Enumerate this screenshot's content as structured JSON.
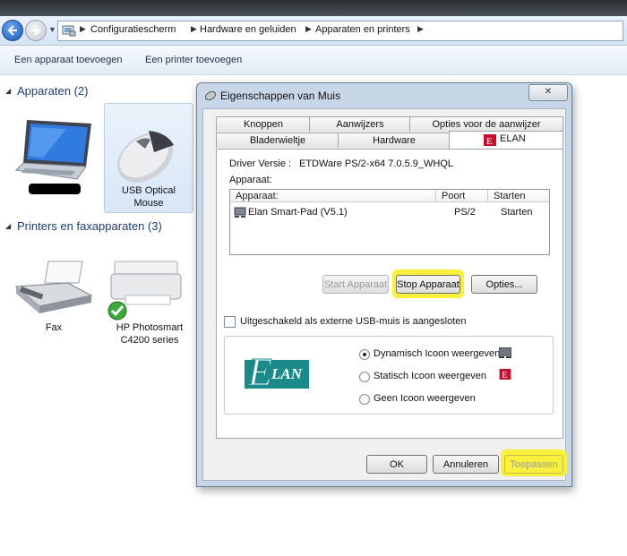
{
  "breadcrumb": [
    "Configuratiescherm",
    "Hardware en geluiden",
    "Apparaten en printers"
  ],
  "commands": {
    "add_device": "Een apparaat toevoegen",
    "add_printer": "Een printer toevoegen"
  },
  "devices": {
    "header": "Apparaten (2)",
    "mouse_label_1": "USB Optical",
    "mouse_label_2": "Mouse"
  },
  "printers": {
    "header": "Printers en faxapparaten (3)",
    "fax": "Fax",
    "hp_1": "HP Photosmart",
    "hp_2": "C4200 series"
  },
  "dialog": {
    "title": "Eigenschappen van Muis",
    "close": "✕",
    "tabs_row1": [
      "Knoppen",
      "Aanwijzers",
      "Opties voor de aanwijzer"
    ],
    "tabs_row2": [
      "Bladerwieltje",
      "Hardware",
      "ELAN"
    ],
    "driver_label": "Driver Versie :",
    "driver_value": "ETDWare PS/2-x64 7.0.5.9_WHQL",
    "apparaat_label": "Apparaat:",
    "columns": [
      "Apparaat:",
      "Poort",
      "Starten"
    ],
    "row": {
      "device": "Elan Smart-Pad  (V5.1)",
      "port": "PS/2",
      "start": "Starten"
    },
    "btn_start": "Start Apparaat",
    "btn_stop": "Stop Apparaat",
    "btn_options": "Opties...",
    "checkbox_label": "Uitgeschakeld als externe USB-muis is aangesloten",
    "logo_text": "LAN",
    "logo_letter": "E",
    "radio_options": [
      "Dynamisch Icoon weergeven",
      "Statisch Icoon weergeven",
      "Geen Icoon weergeven"
    ],
    "radio_selected": 0,
    "ok": "OK",
    "cancel": "Annuleren",
    "apply": "Toepassen"
  },
  "colors": {
    "highlight": "#f8f03a",
    "elan_red": "#c8102e",
    "elan_teal": "#1a8a8a",
    "link_blue": "#1e3c73"
  },
  "icons": [
    "back-arrow-icon",
    "forward-arrow-icon",
    "control-panel-icon",
    "laptop-icon",
    "mouse-icon",
    "fax-icon",
    "printer-icon",
    "checkmark-icon",
    "elan-logo",
    "monitor-icon",
    "elan-icon"
  ]
}
